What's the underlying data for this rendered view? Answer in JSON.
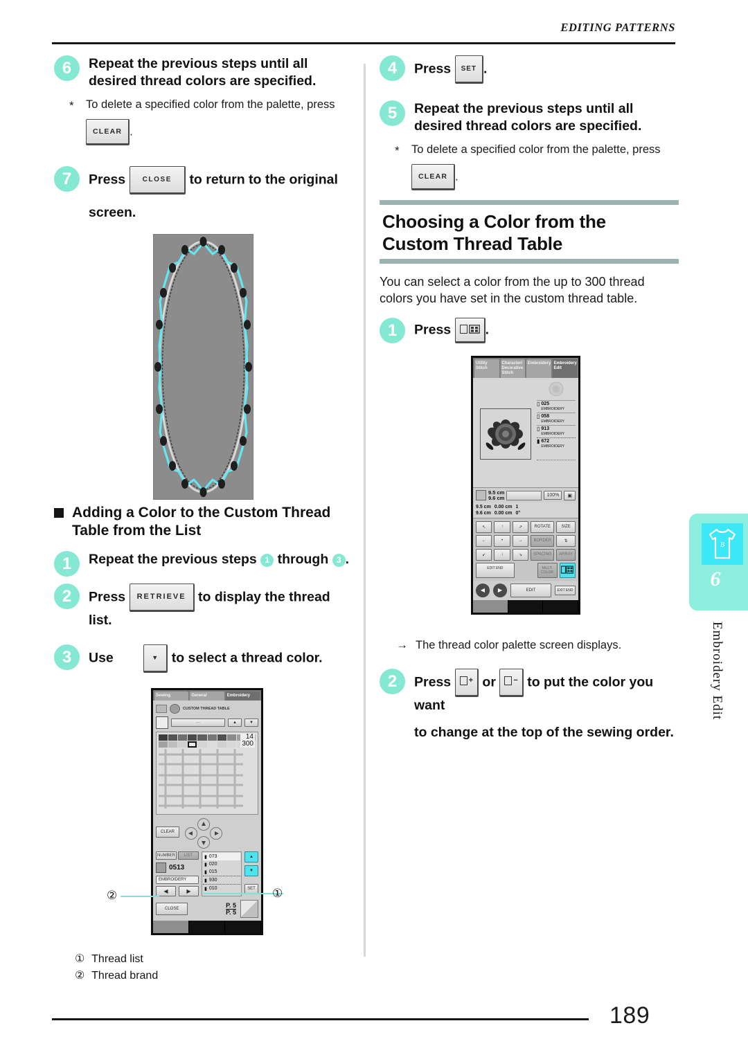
{
  "header": {
    "running_head": "EDITING PATTERNS",
    "page_number": "189"
  },
  "left_column": {
    "step6": {
      "num": "6",
      "text": "Repeat the previous steps until all desired thread colors are specified.",
      "note": "To delete a specified color from the palette, press",
      "note_key": "CLEAR",
      "note_tail": "."
    },
    "step7": {
      "num": "7",
      "lead": "Press",
      "key": "CLOSE",
      "mid": "to return to the original",
      "tail": "screen."
    },
    "subheading": "Adding a Color to the Custom Thread Table from the List",
    "step1": {
      "num": "1",
      "part_a": "Repeat the previous steps",
      "ref_a": "1",
      "part_b": "through",
      "ref_b": "3",
      "part_c": "."
    },
    "step2": {
      "num": "2",
      "lead": "Press",
      "key": "RETRIEVE",
      "tail": "to display the thread list."
    },
    "step3": {
      "num": "3",
      "lead": "Use",
      "key": "▼",
      "tail": "to select a thread color."
    },
    "figure_callouts": [
      {
        "marker": "①",
        "label": "Thread list"
      },
      {
        "marker": "②",
        "label": "Thread brand"
      }
    ],
    "lcd": {
      "tabs": [
        "Sewing",
        "General",
        "Embroidery"
      ],
      "active_tab": "Embroidery",
      "title": "CUSTOM THREAD TABLE",
      "counter_current": "14",
      "counter_total": "300",
      "clear_button": "CLEAR",
      "mode_number": "NUMBER",
      "mode_list": "LIST",
      "color_code": "0513",
      "brand": "EMBROIDERY",
      "set_button": "SET",
      "close_button": "CLOSE",
      "page_indicator_top": "P. 5",
      "page_indicator_bottom": "P. 5",
      "thread_rows": [
        "073",
        "020",
        "015",
        "930",
        "010"
      ],
      "scroll_up": "▲",
      "scroll_down": "▼",
      "nav_left": "◀",
      "nav_right": "▶"
    }
  },
  "right_column": {
    "step4": {
      "num": "4",
      "lead": "Press",
      "key": "SET",
      "tail": "."
    },
    "step5": {
      "num": "5",
      "text": "Repeat the previous steps until all desired thread colors are specified.",
      "note": "To delete a specified color from the palette, press",
      "note_key": "CLEAR",
      "note_tail": "."
    },
    "heading_line1": "Choosing a Color from the",
    "heading_line2": "Custom Thread Table",
    "lead_paragraph": "You can select a color from the up to 300 thread colors you have set in the custom thread table.",
    "step1": {
      "num": "1",
      "lead": "Press",
      "key_icon": "thread-palette-icon",
      "tail": "."
    },
    "result_note": "The thread color palette screen displays.",
    "step2": {
      "num": "2",
      "lead": "Press",
      "key_a": "+",
      "conj": "or",
      "key_b": "−",
      "mid": "to put the color you want",
      "tail": "to change at the top of the sewing order."
    },
    "lcd": {
      "tabs": [
        "Utility Stitch",
        "Character/ Decorative Stitch",
        "Embroidery",
        "Embroidery Edit"
      ],
      "active_tab": "Embroidery Edit",
      "color_list": [
        {
          "code": "025",
          "brand": "EMBROIDERY"
        },
        {
          "code": "058",
          "brand": "EMBROIDERY"
        },
        {
          "code": "913",
          "brand": "EMBROIDERY"
        },
        {
          "code": "672",
          "brand": "EMBROIDERY"
        }
      ],
      "size_w": "9.5 cm",
      "size_h": "9.6 cm",
      "zoom": "100%",
      "pos_w": "9.5 cm",
      "pos_h": "9.6 cm",
      "offset_x": "0.00 cm",
      "offset_y": "0.00 cm",
      "rotation_deg": "0°",
      "count": "1",
      "buttons": [
        "ROTATE",
        "SIZE",
        "BORDER",
        "SPACING",
        "ARRAY",
        "EDIT END",
        "MULTI COLOR"
      ],
      "bottom_left": "EDIT",
      "bottom_right": "EXIT END"
    }
  },
  "thumb_tab": {
    "number": "6",
    "label": "Embroidery Edit",
    "icon": "tshirt-icon",
    "color": "#8ceedd"
  },
  "theme": {
    "accent": "#84e8d2",
    "rule": "#9bb3b0",
    "divider": "#d8d8d8",
    "ink": "#111111"
  }
}
